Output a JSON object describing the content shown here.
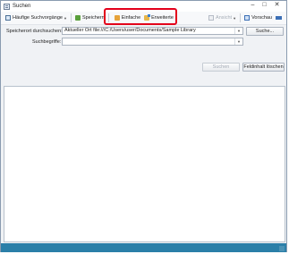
{
  "window": {
    "title": "Suchen",
    "controls": {
      "minimize": "–",
      "maximize": "□",
      "close": "✕"
    }
  },
  "toolbar": {
    "history_label": "Häufige Suchvorgänge",
    "save_label": "Speichern",
    "simple_label": "Einfache",
    "advanced_label": "Erweiterte",
    "view_label": "Ansicht",
    "preview_label": "Vorschau"
  },
  "form": {
    "location_label": "Speicherort durchsuchen:",
    "location_value": "Aktueller Ort file:///C:/Users/user/Documents/Sample Library",
    "browse_label": "Suche...",
    "terms_label": "Suchbegriffe:",
    "terms_value": "",
    "search_button": "Suchen",
    "clear_button": "Feldinhalt löschen"
  },
  "colors": {
    "highlight": "#e3001b",
    "statusbar": "#2b7fa8"
  }
}
